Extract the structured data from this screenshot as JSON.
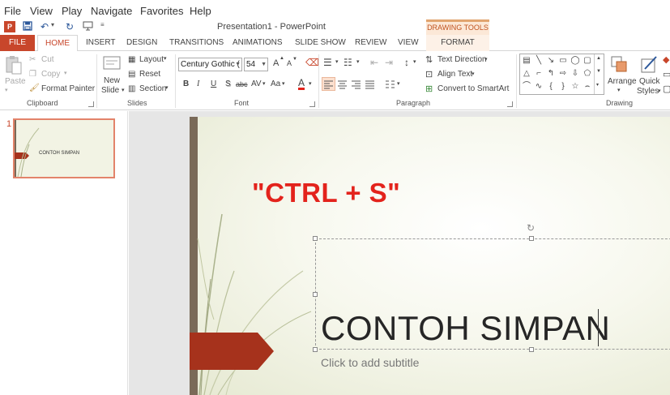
{
  "menubar": {
    "items": [
      "File",
      "View",
      "Play",
      "Navigate",
      "Favorites",
      "Help"
    ]
  },
  "titlebar": {
    "doc_title": "Presentation1 - PowerPoint",
    "contextual_group": "DRAWING TOOLS"
  },
  "tabs": {
    "file": "FILE",
    "home": "HOME",
    "insert": "INSERT",
    "design": "DESIGN",
    "transitions": "TRANSITIONS",
    "animations": "ANIMATIONS",
    "slideshow": "SLIDE SHOW",
    "review": "REVIEW",
    "view": "VIEW",
    "format": "FORMAT"
  },
  "ribbon": {
    "clipboard": {
      "paste": "Paste",
      "cut": "Cut",
      "copy": "Copy",
      "format_painter": "Format Painter",
      "label": "Clipboard"
    },
    "slides": {
      "new_slide_line1": "New",
      "new_slide_line2": "Slide",
      "layout": "Layout",
      "reset": "Reset",
      "section": "Section",
      "label": "Slides"
    },
    "font": {
      "family": "Century Gothic (",
      "size": "54",
      "bold": "B",
      "italic": "I",
      "underline": "U",
      "shadow": "S",
      "strike": "abc",
      "spacing": "AV",
      "case": "Aa",
      "color": "A",
      "grow": "A",
      "shrink": "A",
      "label": "Font"
    },
    "paragraph": {
      "text_direction": "Text Direction",
      "align_text": "Align Text",
      "convert_smartart": "Convert to SmartArt",
      "label": "Paragraph"
    },
    "drawing": {
      "arrange": "Arrange",
      "quick_styles_line1": "Quick",
      "quick_styles_line2": "Styles",
      "label": "Drawing"
    }
  },
  "thumbnails": {
    "number": "1",
    "text": "CONTOH SIMPAN"
  },
  "slide": {
    "annotation": "\"CTRL + S\"",
    "title": "CONTOH SIMPAN",
    "subtitle_placeholder": "Click to add subtitle"
  },
  "colors": {
    "accent": "#c8462b",
    "annotation_red": "#e3231c",
    "drawing_tools_bg": "#fce8d7",
    "slide_ribbon": "#a6321c"
  }
}
